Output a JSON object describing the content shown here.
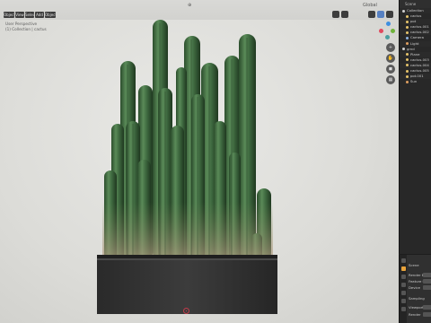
{
  "header": {
    "menus": [
      "Object Mode",
      "View",
      "Select",
      "Add",
      "Object"
    ],
    "right_label": "Global"
  },
  "viewport": {
    "overlay_lines": [
      "User Perspective",
      "(1) Collection | cactus"
    ]
  },
  "gizmo": {
    "x_label": "X",
    "y_label": "Y",
    "z_label": "Z"
  },
  "outliner": {
    "title": "Scene Collection",
    "rows": [
      "Collection",
      "cactus",
      "pot",
      "cactus.001",
      "cactus.002",
      "Camera",
      "Light",
      "grnd",
      "Plane",
      "cactus.003",
      "cactus.004",
      "cactus.005",
      "pot.001",
      "Sun"
    ],
    "colors": {
      "mesh": "#e6c46a",
      "collection": "#d0d0d0",
      "camera": "#8fb3e0",
      "light": "#e0a060"
    }
  },
  "properties": {
    "rows": [
      "Scene",
      "Render Eng",
      "Feature Set",
      "Device",
      "Sampling",
      "Viewport",
      "Render"
    ]
  },
  "colors": {
    "accent": "#e8a33b",
    "x_axis": "#e04a5e",
    "y_axis": "#6fb33a",
    "z_axis": "#3e8fe0"
  }
}
